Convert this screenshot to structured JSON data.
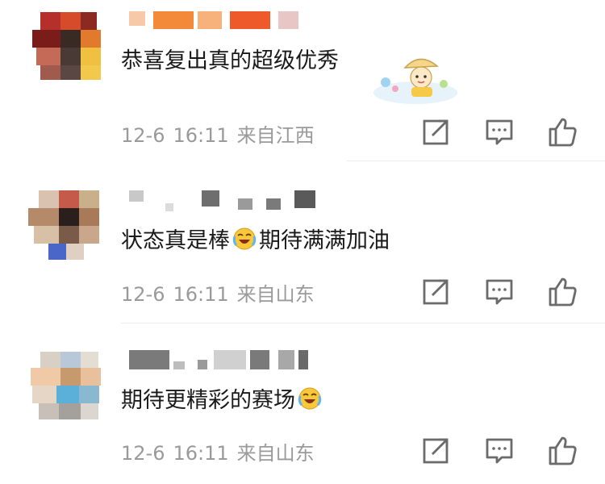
{
  "comments": [
    {
      "text": "恭喜复出真的超级优秀",
      "date": "12-6",
      "time": "16:11",
      "location": "来自江西",
      "has_sticker": true
    },
    {
      "text_before": "状态真是棒",
      "text_after": "期待满满加油",
      "date": "12-6",
      "time": "16:11",
      "location": "来自山东"
    },
    {
      "text_before": "期待更精彩的赛场",
      "date": "12-6",
      "time": "16:11",
      "location": "来自山东"
    }
  ],
  "icons": {
    "share": "share-icon",
    "comment": "comment-icon",
    "like": "thumbs-up-icon",
    "emoji": "crying-laughing-emoji"
  },
  "colors": {
    "text": "#1a1a1a",
    "meta": "#9a9a9a",
    "icon": "#6b6b6b"
  }
}
